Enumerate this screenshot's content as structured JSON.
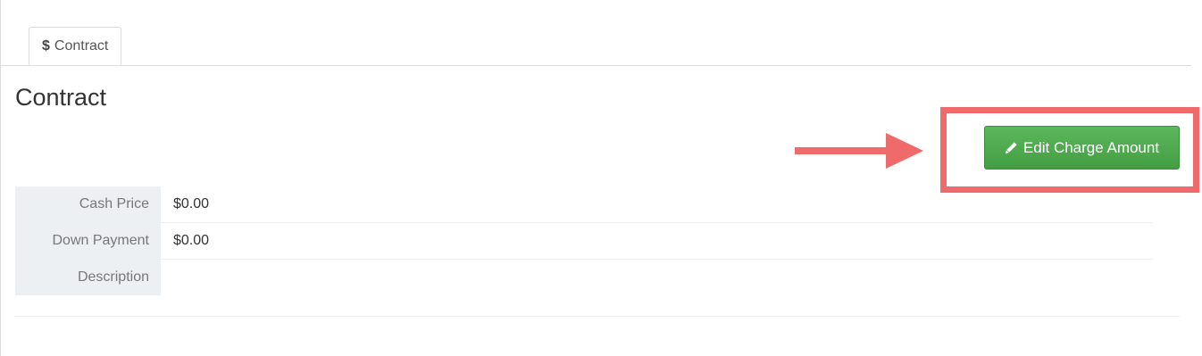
{
  "tabs": [
    {
      "icon": "dollar-icon",
      "icon_glyph": "$",
      "label": "Contract"
    }
  ],
  "main": {
    "title": "Contract",
    "edit_button": {
      "icon": "pencil-icon",
      "label": "Edit Charge Amount",
      "color": "#5cb85c"
    },
    "details": [
      {
        "label": "Cash Price",
        "value": "$0.00"
      },
      {
        "label": "Down Payment",
        "value": "$0.00"
      },
      {
        "label": "Description",
        "value": ""
      }
    ]
  },
  "annotation": {
    "color": "#ef6b6b"
  }
}
